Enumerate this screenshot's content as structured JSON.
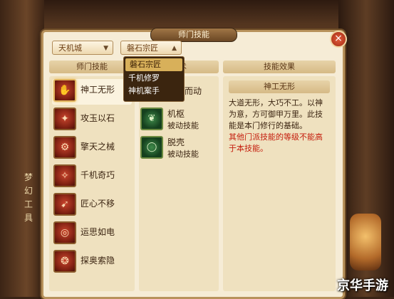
{
  "window": {
    "title": "师门技能"
  },
  "dropdowns": {
    "sect": {
      "value": "天机城"
    },
    "branch": {
      "value": "磐石宗匠"
    },
    "branch_options": [
      "磐石宗匠",
      "千机修罗",
      "神机案手"
    ]
  },
  "columns": {
    "skills_header": "师门技能",
    "methods_header": "法术",
    "effect_header": "技能效果"
  },
  "skills": [
    {
      "name": "神工无形",
      "glyph": "✋"
    },
    {
      "name": "攻玉以石",
      "glyph": "✦"
    },
    {
      "name": "擎天之械",
      "glyph": "⚙"
    },
    {
      "name": "千机奇巧",
      "glyph": "✧"
    },
    {
      "name": "匠心不移",
      "glyph": "➹"
    },
    {
      "name": "运思如电",
      "glyph": "◎"
    },
    {
      "name": "探奥索隐",
      "glyph": "❂"
    }
  ],
  "methods": [
    {
      "name": "一发而动",
      "type": ""
    },
    {
      "name": "机枢",
      "type": "被动技能"
    },
    {
      "name": "脱壳",
      "type": "被动技能"
    }
  ],
  "effect": {
    "title": "神工无形",
    "body": "大道无形，大巧不工。以神为意，方可御甲万里。此技能是本门修行的基础。",
    "warning": "其他门派技能的等级不能高于本技能。"
  },
  "scene": {
    "sign": "梦幻工具",
    "watermark": "京华手游"
  },
  "colors": {
    "accent": "#d8b05a",
    "warning": "#c41c0c",
    "frame": "#b8925c"
  }
}
